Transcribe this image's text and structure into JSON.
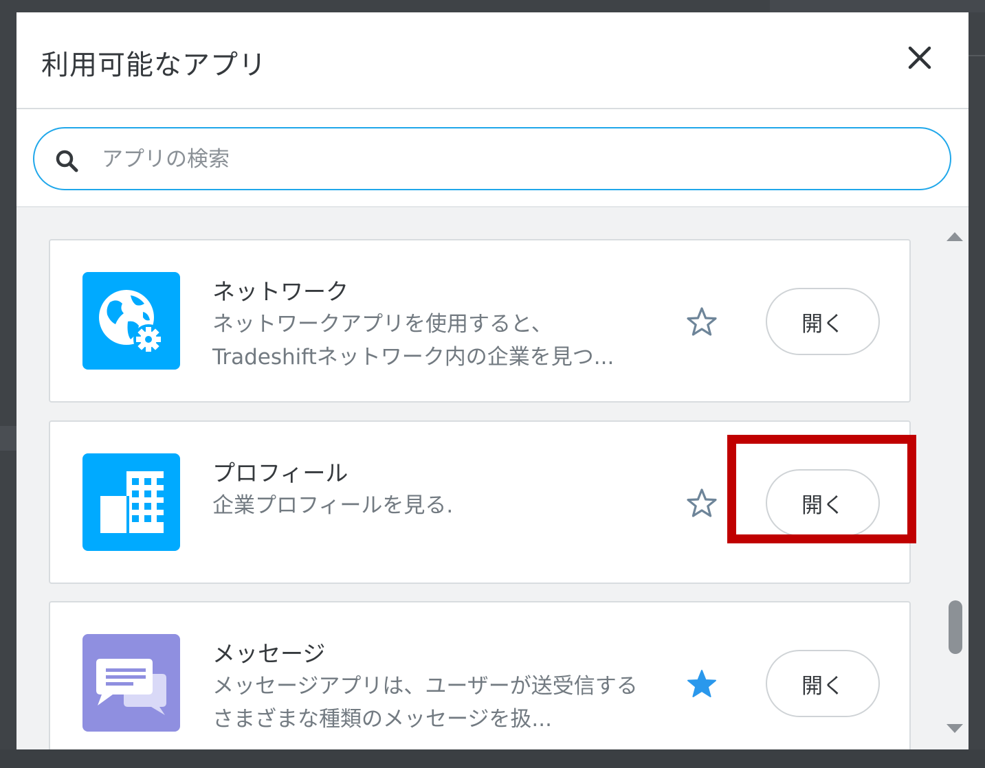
{
  "modal": {
    "title": "利用可能なアプリ",
    "close_icon": "close-icon"
  },
  "search": {
    "placeholder": "アプリの検索",
    "value": "",
    "icon": "search-icon"
  },
  "apps": [
    {
      "name": "ネットワーク",
      "description": "ネットワークアプリを使用すると、Tradeshiftネットワーク内の企業を見つ...",
      "icon": "globe-gear-icon",
      "icon_color": "#00aaff",
      "favorited": false,
      "open_label": "開く"
    },
    {
      "name": "プロフィール",
      "description": "企業プロフィールを見る.",
      "icon": "building-icon",
      "icon_color": "#00aaff",
      "favorited": false,
      "open_label": "開く"
    },
    {
      "name": "メッセージ",
      "description": "メッセージアプリは、ユーザーが送受信するさまざまな種類のメッセージを扱...",
      "icon": "chat-bubbles-icon",
      "icon_color": "#8f8fe0",
      "favorited": true,
      "open_label": "開く"
    }
  ],
  "colors": {
    "accent": "#1fa7ea",
    "star_outline": "#6e8599",
    "star_filled": "#2a98ec",
    "highlight": "#c00000"
  }
}
